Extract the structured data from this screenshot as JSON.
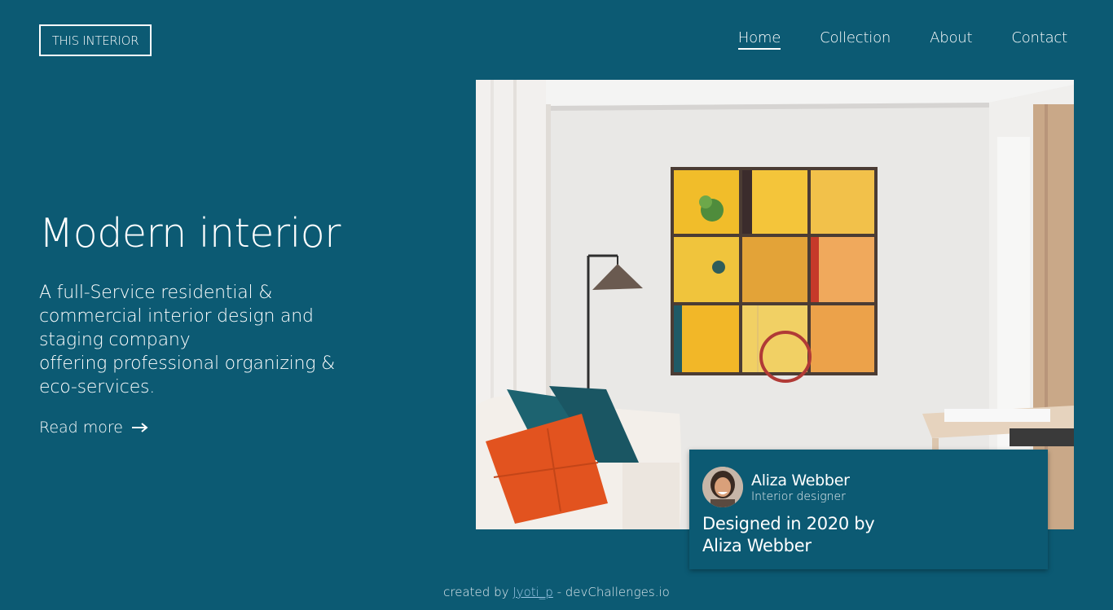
{
  "brand": {
    "logo_text": "THIS INTERIOR"
  },
  "nav": {
    "items": [
      {
        "label": "Home",
        "active": true
      },
      {
        "label": "Collection",
        "active": false
      },
      {
        "label": "About",
        "active": false
      },
      {
        "label": "Contact",
        "active": false
      }
    ]
  },
  "hero": {
    "title": "Modern interior",
    "description_lines": [
      "A full-Service residential &",
      "commercial interior design and",
      "staging company",
      "offering professional organizing &",
      "eco-services."
    ],
    "read_more_label": "Read more"
  },
  "card": {
    "designer_name": "Aliza Webber",
    "designer_role": "Interior designer",
    "caption": "Designed in 2020 by Aliza Webber"
  },
  "footer": {
    "prefix": "created by",
    "author": "Jyoti_p",
    "suffix": "- devChallenges.io"
  },
  "colors": {
    "background": "#0c5a73",
    "text": "#ffffff",
    "footer_link": "#9cc7e6"
  },
  "icons": {
    "read_more": "arrow-right-icon"
  }
}
